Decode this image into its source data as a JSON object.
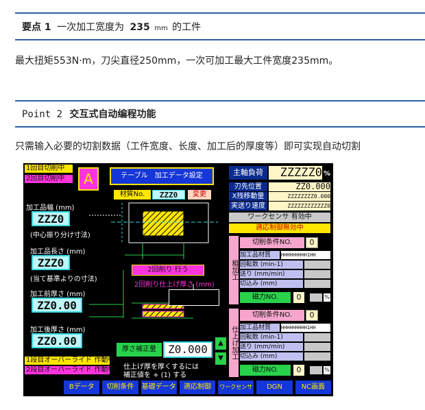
{
  "section1": {
    "prefix": "要点 1",
    "title_a": "一次加工宽度为",
    "title_num": "235",
    "title_unit": "mm",
    "title_b": "的工件",
    "body": "最大扭矩553N·m，刀尖直径250mm，一次可加工最大工件宽度235mm。"
  },
  "section2": {
    "prefix": "Point 2",
    "title": "交互式自动编程功能",
    "body": "只需输入必要的切割数据（工件宽度、长度、加工后的厚度等）即可实现自动切割"
  },
  "screen": {
    "status_1": "1回目切削中",
    "status_2": "2回目切削中",
    "mode_letter": "A",
    "screen_title": "テーブル　加工データ設定",
    "material_label": "材質No.",
    "material_value": "ZZZ0",
    "change_button": "変更",
    "work_width_label": "加工品幅 (mm)",
    "work_width_value": "ZZZ0",
    "work_width_note": "(中心振り分け寸法)",
    "work_length_label": "加工品長さ (mm)",
    "work_length_value": "ZZZ0",
    "work_length_note": "(当て基準よりの寸法)",
    "pre_thickness_label": "加工前厚さ (mm)",
    "pre_thickness_value": "ZZ0.00",
    "post_thickness_label": "加工後厚さ (mm)",
    "post_thickness_value": "ZZ0.00",
    "second_cut_button": "2回削り 行う",
    "second_cut_thickness_label": "2回削り仕上げ厚さ (mm)",
    "thickness_correction_label": "厚さ補正量",
    "thickness_correction_value": "Z0.000",
    "correction_note_1": "仕上げ厚を厚くするには",
    "correction_note_2": "補正値を + (1) する",
    "overdrive_1": "1段目オーバーライド 作動中",
    "overdrive_2": "2段目オーバーライド 作動中",
    "spindle_load_label": "主軸負荷",
    "spindle_load_value": "ZZZZZ0",
    "spindle_load_unit": "%",
    "tool_pos_label": "刃先位置",
    "tool_pos_value": "ZZ0.000",
    "x_remaining_label": "X残移動量",
    "x_remaining_value": "ZZZZZZZZ0.000",
    "feed_speed_label": "実送り速度",
    "feed_speed_value": "ZZZZZZZZZZZZ0",
    "work_sensor": "ワークセンサ 有効中",
    "adaptive_off": "適応制御無効中",
    "rough_vertical": "粗加工",
    "finish_vertical": "仕上げ加工",
    "rough": {
      "cond_label": "切削条件NO.",
      "cond_value": "0",
      "material_label": "加工品材質",
      "material_value": "HHHHHHHHH1HH",
      "rpm_label": "回転数 (min-1)",
      "feed_label": "送り (mm/min)",
      "depth_label": "切込み (mm)",
      "mag_label": "磁力NO.",
      "mag_value": "0",
      "percent": "%"
    },
    "finish": {
      "cond_label": "切削条件NO.",
      "cond_value": "0",
      "material_label": "加工品材質",
      "material_value": "HHHHHHHHH1HH",
      "rpm_label": "回転数 (min-1)",
      "feed_label": "送り (mm/min)",
      "depth_label": "切込み (mm)",
      "mag_label": "磁力NO.",
      "mag_value": "0",
      "percent": "%"
    },
    "up_arrow": "▲",
    "down_arrow": "▼",
    "tabs": [
      "Bデータ",
      "切削条件",
      "基礎データ",
      "適応制御",
      "ワークセンサ",
      "DGN",
      "NC画面"
    ]
  },
  "colors": {
    "rule": "#2d5fa0",
    "screen_bg": "#000000",
    "accent_yellow": "#ffe600",
    "accent_magenta": "#ff33dd",
    "accent_cyan": "#37d6df",
    "button_blue": "#1536d8"
  }
}
